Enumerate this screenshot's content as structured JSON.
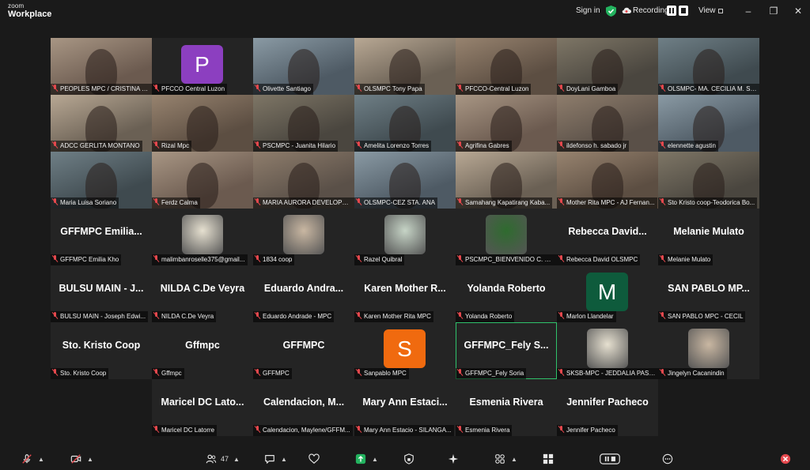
{
  "app": {
    "brand_top": "zoom",
    "brand_bottom": "Workplace"
  },
  "titlebar": {
    "sign_in": "Sign in",
    "recording": "Recording...",
    "view": "View"
  },
  "participant_count": "47",
  "colors": {
    "active_border": "#2fc26b",
    "muted_mic": "#e5484d",
    "share_green": "#23b35f",
    "leave_red": "#e5484d"
  },
  "rows": [
    [
      {
        "type": "video",
        "label": "PEOPLES MPC / CRISTINA V..."
      },
      {
        "type": "letter",
        "letter": "P",
        "color": "#8c3fc0",
        "label": "PFCCO Central Luzon"
      },
      {
        "type": "video",
        "label": "Olivette Santiago"
      },
      {
        "type": "video",
        "label": "OLSMPC Tony Papa"
      },
      {
        "type": "video",
        "label": "PFCCO-Central Luzon"
      },
      {
        "type": "video",
        "label": "DoyLani Gamboa"
      },
      {
        "type": "video",
        "label": "OLSMPC- MA. CECILIA M. ST..."
      }
    ],
    [
      {
        "type": "video",
        "label": "ADCC GERLITA MONTANO"
      },
      {
        "type": "video",
        "label": "Rizal Mpc"
      },
      {
        "type": "video",
        "label": "PSCMPC - Juanita Hilario"
      },
      {
        "type": "video",
        "label": "Amelita Lorenzo Torres"
      },
      {
        "type": "video",
        "label": "Agrifina Gabres"
      },
      {
        "type": "video",
        "label": "ildefonso h. sabado jr"
      },
      {
        "type": "video",
        "label": "elennette agustin"
      }
    ],
    [
      {
        "type": "video",
        "label": "Maria Luisa Soriano"
      },
      {
        "type": "video",
        "label": "Ferdz Calma"
      },
      {
        "type": "video",
        "label": "MARIA AURORA DEVELOPMEN..."
      },
      {
        "type": "video",
        "label": "OLSMPC-CEZ STA. ANA"
      },
      {
        "type": "video",
        "label": "Samahang Kapatirang Kaba..."
      },
      {
        "type": "video",
        "label": "Mother Rita MPC - AJ Fernan..."
      },
      {
        "type": "video",
        "label": "Sto Kristo coop-Teodorica Bo..."
      }
    ],
    [
      {
        "type": "name",
        "big": "GFFMPC Emilia...",
        "label": "GFFMPC Emilia Kho"
      },
      {
        "type": "image",
        "label": "malimbanroselle375@gmail..."
      },
      {
        "type": "image",
        "label": "1834 coop"
      },
      {
        "type": "image",
        "label": "Razel Quibral"
      },
      {
        "type": "image",
        "label": "PSCMPC_BIENVENIDO C. CA..."
      },
      {
        "type": "name",
        "big": "Rebecca David...",
        "label": "Rebecca David OLSMPC"
      },
      {
        "type": "name",
        "big": "Melanie Mulato",
        "label": "Melanie Mulato"
      }
    ],
    [
      {
        "type": "name",
        "big": "BULSU MAIN - J...",
        "label": "BULSU MAIN - Joseph Edwi..."
      },
      {
        "type": "name",
        "big": "NILDA C.De Veyra",
        "label": "NILDA C.De Veyra"
      },
      {
        "type": "name",
        "big": "Eduardo Andra...",
        "label": "Eduardo Andrade - MPC"
      },
      {
        "type": "name",
        "big": "Karen Mother R...",
        "label": "Karen Mother Rita MPC"
      },
      {
        "type": "name",
        "big": "Yolanda Roberto",
        "label": "Yolanda Roberto"
      },
      {
        "type": "letter",
        "letter": "M",
        "color": "#0e5b3c",
        "label": "Marlon Llandelar"
      },
      {
        "type": "name",
        "big": "SAN PABLO MP...",
        "label": "SAN PABLO MPC - CECIL"
      }
    ],
    [
      {
        "type": "name",
        "big": "Sto. Kristo Coop",
        "label": "Sto. Kristo Coop"
      },
      {
        "type": "name",
        "big": "Gffmpc",
        "label": "Gffmpc"
      },
      {
        "type": "name",
        "big": "GFFMPC",
        "label": "GFFMPC"
      },
      {
        "type": "letter",
        "letter": "S",
        "color": "#f06a0f",
        "label": "Sanpablo MPC"
      },
      {
        "type": "name",
        "big": "GFFMPC_Fely S...",
        "label": "GFFMPC_Fely Soria",
        "active": true
      },
      {
        "type": "image",
        "label": "SKSB-MPC - JEDDALIA PAST..."
      },
      {
        "type": "image",
        "label": "Jingelyn Cacanindin"
      }
    ],
    [
      {
        "type": "name",
        "big": "Maricel DC Lato...",
        "label": "Maricel DC Latorre"
      },
      {
        "type": "name",
        "big": "Calendacion, M...",
        "label": "Calendacion, Maylene/GFFM..."
      },
      {
        "type": "name",
        "big": "Mary Ann Estaci...",
        "label": "Mary Ann Estacio - SILANGA..."
      },
      {
        "type": "name",
        "big": "Esmenia Rivera",
        "label": "Esmenia Rivera"
      },
      {
        "type": "name",
        "big": "Jennifer Pacheco",
        "label": "Jennifer Pacheco"
      }
    ]
  ]
}
